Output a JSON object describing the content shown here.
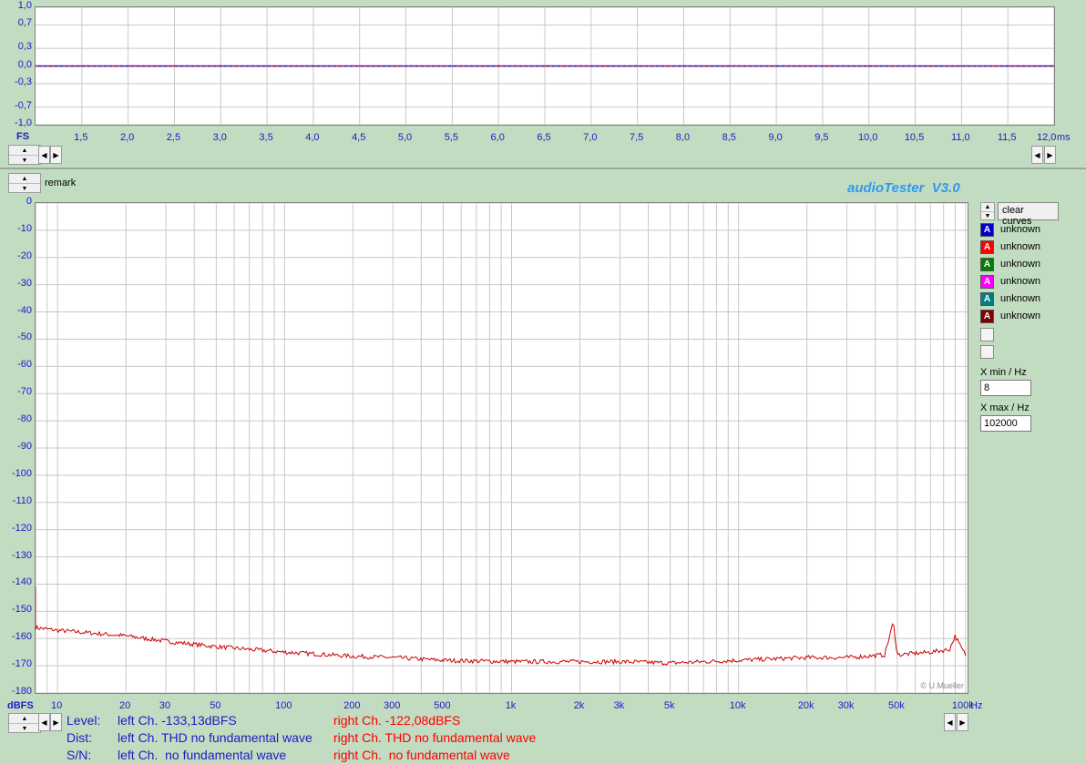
{
  "scope": {
    "y_labels": [
      "1,0",
      "0,7",
      "0,3",
      "0,0",
      "-0,3",
      "-0,7",
      "-1,0"
    ],
    "y_values": [
      1.0,
      0.7,
      0.3,
      0.0,
      -0.3,
      -0.7,
      -1.0
    ],
    "x_labels": [
      "1,5",
      "2,0",
      "2,5",
      "3,0",
      "3,5",
      "4,0",
      "4,5",
      "5,0",
      "5,5",
      "6,0",
      "6,5",
      "7,0",
      "7,5",
      "8,0",
      "8,5",
      "9,0",
      "9,5",
      "10,0",
      "10,5",
      "11,0",
      "11,5",
      "12,0"
    ],
    "x_unit": "ms",
    "y_unit": "FS"
  },
  "header": {
    "remark": "remark",
    "app_title": "audioTester  V3.0"
  },
  "spectrum": {
    "y_labels": [
      "0",
      "-10",
      "-20",
      "-30",
      "-40",
      "-50",
      "-60",
      "-70",
      "-80",
      "-90",
      "-100",
      "-110",
      "-120",
      "-130",
      "-140",
      "-150",
      "-160",
      "-170",
      "-180"
    ],
    "x_labels": [
      "10",
      "20",
      "30",
      "50",
      "100",
      "200",
      "300",
      "500",
      "1k",
      "2k",
      "3k",
      "5k",
      "10k",
      "20k",
      "30k",
      "50k",
      "100k"
    ],
    "x_unit": "Hz",
    "y_unit": "dBFS",
    "copyright": "© U.Mueller"
  },
  "chart_data": {
    "type": "line",
    "xlabel": "Hz",
    "ylabel": "dBFS",
    "x_scale": "log",
    "xlim": [
      8,
      102000
    ],
    "ylim": [
      -180,
      0
    ],
    "series": [
      {
        "color": "#cc0000",
        "x": [
          8,
          10,
          20,
          30,
          50,
          100,
          200,
          300,
          500,
          1000,
          2000,
          3000,
          5000,
          10000,
          20000,
          30000,
          44000,
          48000,
          50000,
          70000,
          85000,
          90000,
          95000,
          100000
        ],
        "y": [
          -156,
          -157,
          -159,
          -161,
          -163,
          -165,
          -166.5,
          -167,
          -168,
          -168.5,
          -168.5,
          -168.5,
          -169,
          -168,
          -167,
          -167,
          -166,
          -154,
          -166,
          -165,
          -164,
          -159,
          -163,
          -166
        ]
      }
    ]
  },
  "legend": {
    "clear_label": "clear curves",
    "items": [
      {
        "letter": "A",
        "label": "unknown",
        "color": "#0000cc"
      },
      {
        "letter": "A",
        "label": "unknown",
        "color": "#ff0000"
      },
      {
        "letter": "A",
        "label": "unknown",
        "color": "#008000"
      },
      {
        "letter": "A",
        "label": "unknown",
        "color": "#ff00ff"
      },
      {
        "letter": "A",
        "label": "unknown",
        "color": "#008080"
      },
      {
        "letter": "A",
        "label": "unknown",
        "color": "#800000"
      }
    ]
  },
  "xrange": {
    "min_label": "X min / Hz",
    "min_value": "8",
    "max_label": "X max / Hz",
    "max_value": "102000"
  },
  "status": {
    "level_label": "Level:",
    "dist_label": "Dist:",
    "sn_label": "S/N:",
    "level_left": "left Ch. -133,13dBFS",
    "level_right": "right Ch. -122,08dBFS",
    "dist_left": "left Ch. THD no fundamental wave",
    "dist_right": "right Ch. THD no fundamental wave",
    "sn_left": "left Ch.  no fundamental wave",
    "sn_right": "right Ch.  no fundamental wave",
    "left_color": "#1c1cc8",
    "right_color": "#ff0000"
  }
}
